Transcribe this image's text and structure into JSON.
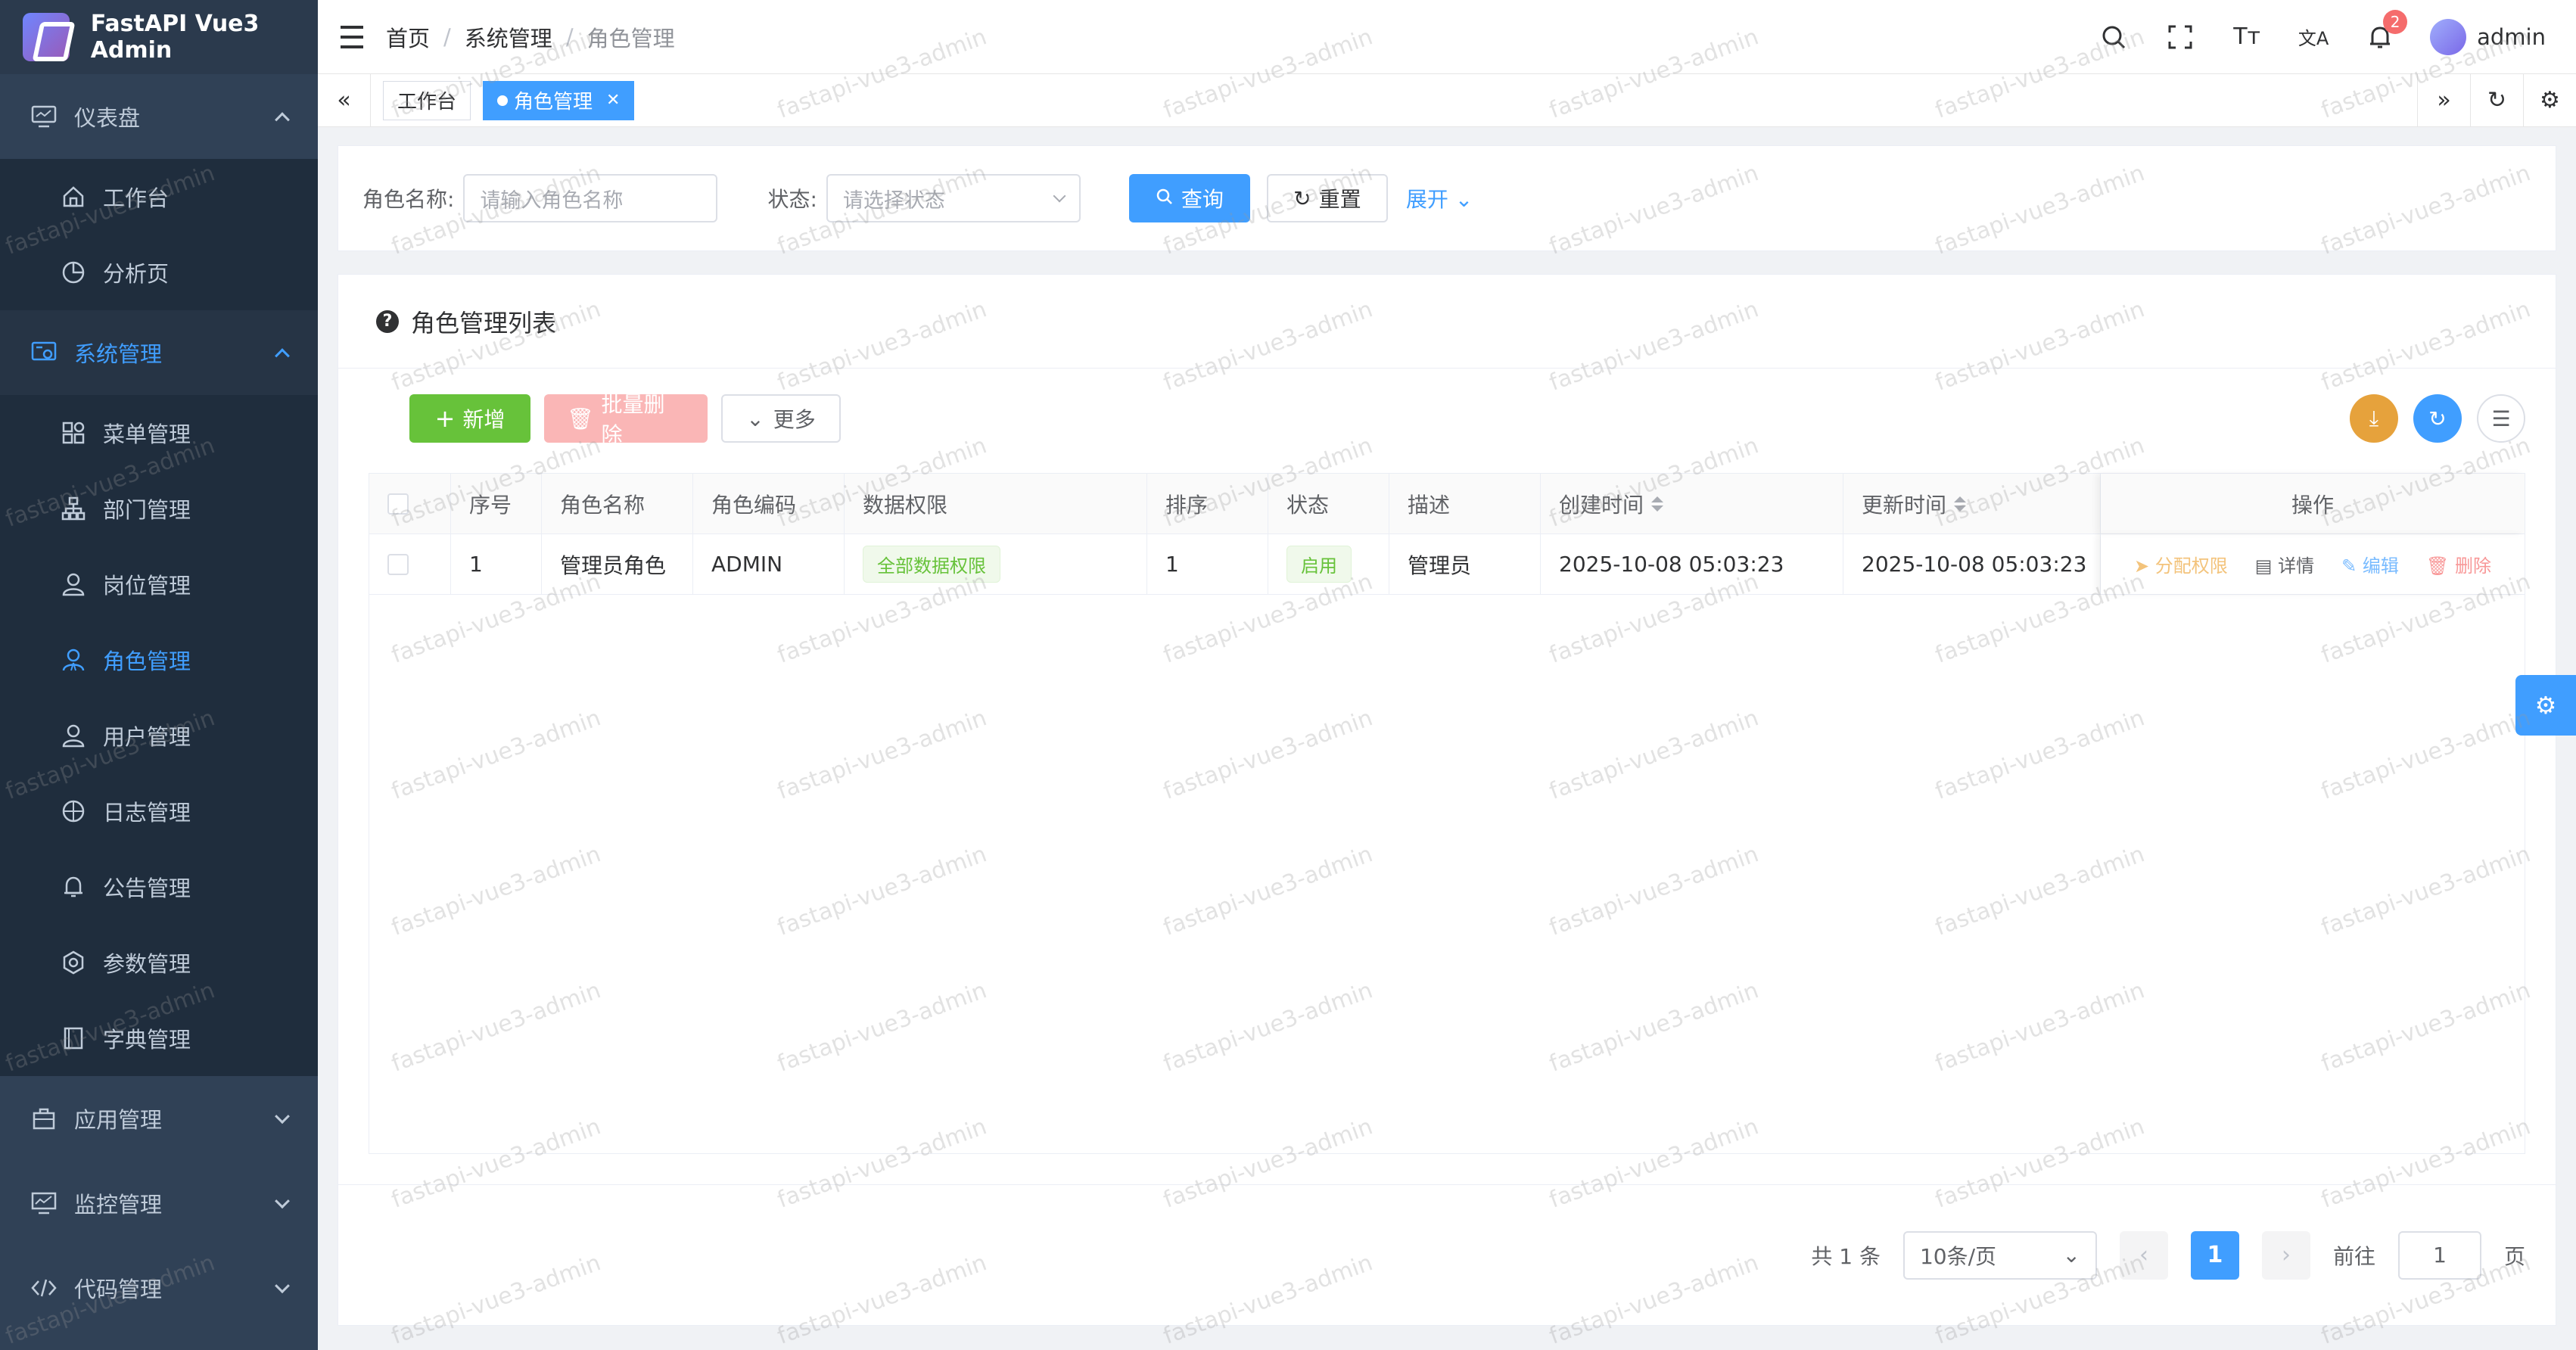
{
  "app": {
    "title": "FastAPI Vue3 Admin"
  },
  "sidebar": {
    "groups": [
      {
        "label": "仪表盘",
        "icon": "monitor-icon",
        "expanded": true,
        "items": [
          {
            "label": "工作台",
            "icon": "home-icon"
          },
          {
            "label": "分析页",
            "icon": "pie-icon"
          }
        ]
      },
      {
        "label": "系统管理",
        "icon": "system-icon",
        "expanded": true,
        "active": true,
        "items": [
          {
            "label": "菜单管理",
            "icon": "grid-icon"
          },
          {
            "label": "部门管理",
            "icon": "org-icon"
          },
          {
            "label": "岗位管理",
            "icon": "user-icon"
          },
          {
            "label": "角色管理",
            "icon": "user-role-icon",
            "active": true
          },
          {
            "label": "用户管理",
            "icon": "user-icon"
          },
          {
            "label": "日志管理",
            "icon": "globe-icon"
          },
          {
            "label": "公告管理",
            "icon": "bell-icon"
          },
          {
            "label": "参数管理",
            "icon": "gear-icon"
          },
          {
            "label": "字典管理",
            "icon": "book-icon"
          }
        ]
      },
      {
        "label": "应用管理",
        "icon": "briefcase-icon"
      },
      {
        "label": "监控管理",
        "icon": "monitor-chart-icon"
      },
      {
        "label": "代码管理",
        "icon": "code-icon"
      }
    ]
  },
  "header": {
    "breadcrumb": [
      "首页",
      "系统管理",
      "角色管理"
    ],
    "notification_count": "2",
    "username": "admin",
    "font_size_glyph": "Tт",
    "translate_glyph": "文A"
  },
  "tags": [
    {
      "label": "工作台"
    },
    {
      "label": "角色管理",
      "active": true
    }
  ],
  "search": {
    "role_name_label": "角色名称:",
    "role_name_placeholder": "请输入角色名称",
    "status_label": "状态:",
    "status_placeholder": "请选择状态",
    "query_label": "查询",
    "reset_label": "重置",
    "expand_label": "展开"
  },
  "table_card": {
    "title": "角色管理列表",
    "add_label": "新增",
    "batch_delete_label": "批量删除",
    "more_label": "更多",
    "columns": [
      "序号",
      "角色名称",
      "角色编码",
      "数据权限",
      "排序",
      "状态",
      "描述",
      "创建时间",
      "更新时间",
      "操作"
    ],
    "rows": [
      {
        "index": "1",
        "name": "管理员角色",
        "code": "ADMIN",
        "data_scope": "全部数据权限",
        "sort": "1",
        "status": "启用",
        "desc": "管理员",
        "created": "2025-10-08 05:03:23",
        "updated": "2025-10-08 05:03:23"
      }
    ],
    "ops": {
      "assign": "分配权限",
      "detail": "详情",
      "edit": "编辑",
      "delete": "删除"
    }
  },
  "pager": {
    "total_text": "共 1 条",
    "page_size": "10条/页",
    "current_page": "1",
    "goto_label": "前往",
    "goto_value": "1",
    "page_suffix": "页"
  },
  "watermark": "fastapi-vue3-admin",
  "colors": {
    "primary": "#409eff",
    "sidebar": "#304156",
    "success": "#67c23a",
    "warning": "#e6a23c"
  }
}
